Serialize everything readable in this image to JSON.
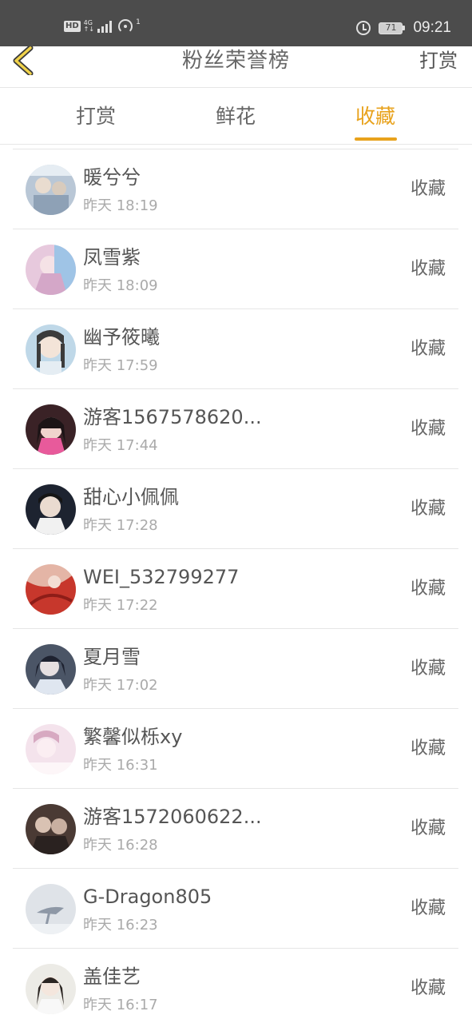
{
  "status_bar": {
    "hd": "HD",
    "network": "4G",
    "network_sub": "↑↓",
    "hotspot_count": "1",
    "battery": "71",
    "time": "09:21"
  },
  "header": {
    "title": "粉丝荣誉榜",
    "action": "打赏",
    "back_icon": "chevron-left-icon"
  },
  "tabs": [
    {
      "label": "打赏",
      "active": false
    },
    {
      "label": "鲜花",
      "active": false
    },
    {
      "label": "收藏",
      "active": true
    }
  ],
  "colors": {
    "accent": "#e8a21c",
    "status_bar": "#4c4c4c"
  },
  "fans": [
    {
      "name": "暖兮兮",
      "time": "昨天 18:19",
      "action": "收藏"
    },
    {
      "name": "凤雪紫",
      "time": "昨天 18:09",
      "action": "收藏"
    },
    {
      "name": "幽予筱曦",
      "time": "昨天 17:59",
      "action": "收藏"
    },
    {
      "name": "游客1567578620...",
      "time": "昨天 17:44",
      "action": "收藏"
    },
    {
      "name": "甜心小佩佩",
      "time": "昨天 17:28",
      "action": "收藏"
    },
    {
      "name": "WEI_532799277",
      "time": "昨天 17:22",
      "action": "收藏"
    },
    {
      "name": "夏月雪",
      "time": "昨天 17:02",
      "action": "收藏"
    },
    {
      "name": "繁馨似栎xy",
      "time": "昨天 16:31",
      "action": "收藏"
    },
    {
      "name": "游客1572060622...",
      "time": "昨天 16:28",
      "action": "收藏"
    },
    {
      "name": "G-Dragon805",
      "time": "昨天 16:23",
      "action": "收藏"
    },
    {
      "name": "盖佳艺",
      "time": "昨天 16:17",
      "action": "收藏"
    }
  ]
}
